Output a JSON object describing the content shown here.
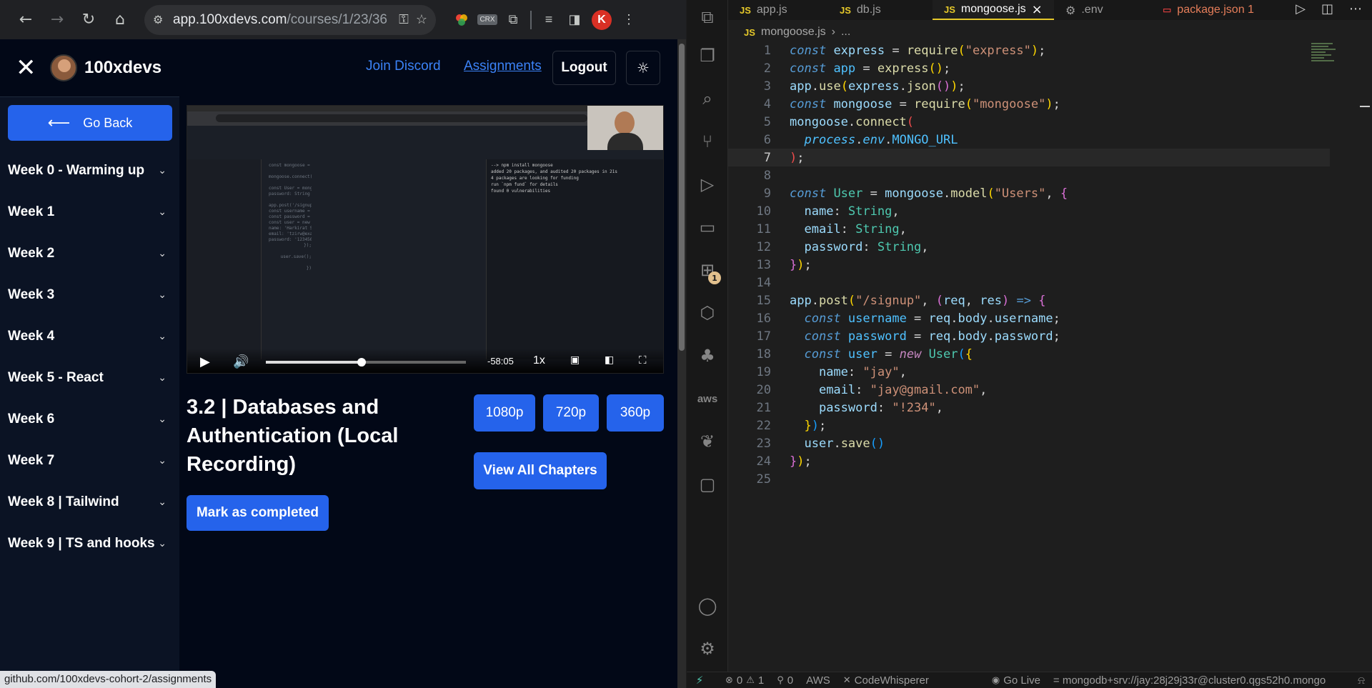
{
  "browser": {
    "url_host": "app.100xdevs.com",
    "url_path": "/courses/1/23/36",
    "status_url": "github.com/100xdevs-cohort-2/assignments",
    "crx_label": "CRX",
    "profile_initial": "K"
  },
  "site": {
    "brand": "100xdevs",
    "nav": {
      "join_discord": "Join Discord",
      "assignments": "Assignments",
      "logout": "Logout"
    },
    "go_back": "Go Back",
    "weeks": [
      "Week 0 - Warming up",
      "Week 1",
      "Week 2",
      "Week 3",
      "Week 4",
      "Week 5 - React",
      "Week 6",
      "Week 7",
      "Week 8 | Tailwind",
      "Week 9 | TS and hooks"
    ],
    "video": {
      "time_left": "-58:05",
      "speed": "1x",
      "progress": 0.48,
      "inner_code": [
        "const mongoose = require('mongoose');",
        "",
        "mongoose.connect(\"mongodb+srv://admin:f135o1a3...\");",
        "",
        "const User = mongoose.model('Users', { name: String, email: String,",
        "password: String });",
        "",
        "app.post('/signup', function(req, res) {",
        "  const username = req.body.username;",
        "  const password = req.body.password;",
        "  const user = new User({",
        "    name: 'Harkirat Singh',",
        "    email: 'tzirw@example.com',",
        "    password: '123456'",
        "  });",
        "",
        "  user.save();",
        "",
        "})"
      ],
      "inner_console": [
        "--> npm install mongoose",
        "added 20 packages, and audited 20 packages in 21s",
        "4 packages are looking for funding",
        "  run `npm fund` for details",
        "found 0 vulnerabilities"
      ]
    },
    "lesson_title": "3.2 | Databases and Authentication (Local Recording)",
    "quality": [
      "1080p",
      "720p",
      "360p"
    ],
    "view_all": "View All Chapters",
    "mark_completed": "Mark as completed"
  },
  "vscode": {
    "tabs": [
      {
        "name": "app.js",
        "kind": "js"
      },
      {
        "name": "db.js",
        "kind": "js"
      },
      {
        "name": "mongoose.js",
        "kind": "js",
        "active": true
      },
      {
        "name": ".env",
        "kind": "gear"
      },
      {
        "name": "package.json 1",
        "kind": "npm",
        "warn": true
      }
    ],
    "breadcrumb": {
      "file": "mongoose.js",
      "rest": "..."
    },
    "activity_badge": "1",
    "aws_label": "aws",
    "current_line": 7,
    "status": {
      "errors": "0",
      "warnings": "1",
      "ports": "0",
      "aws": "AWS",
      "codewhisperer": "CodeWhisperer",
      "golive": "Go Live",
      "env": "= mongodb+srv://jay:28j29j33r@cluster0.qgs52h0.mongo"
    }
  }
}
